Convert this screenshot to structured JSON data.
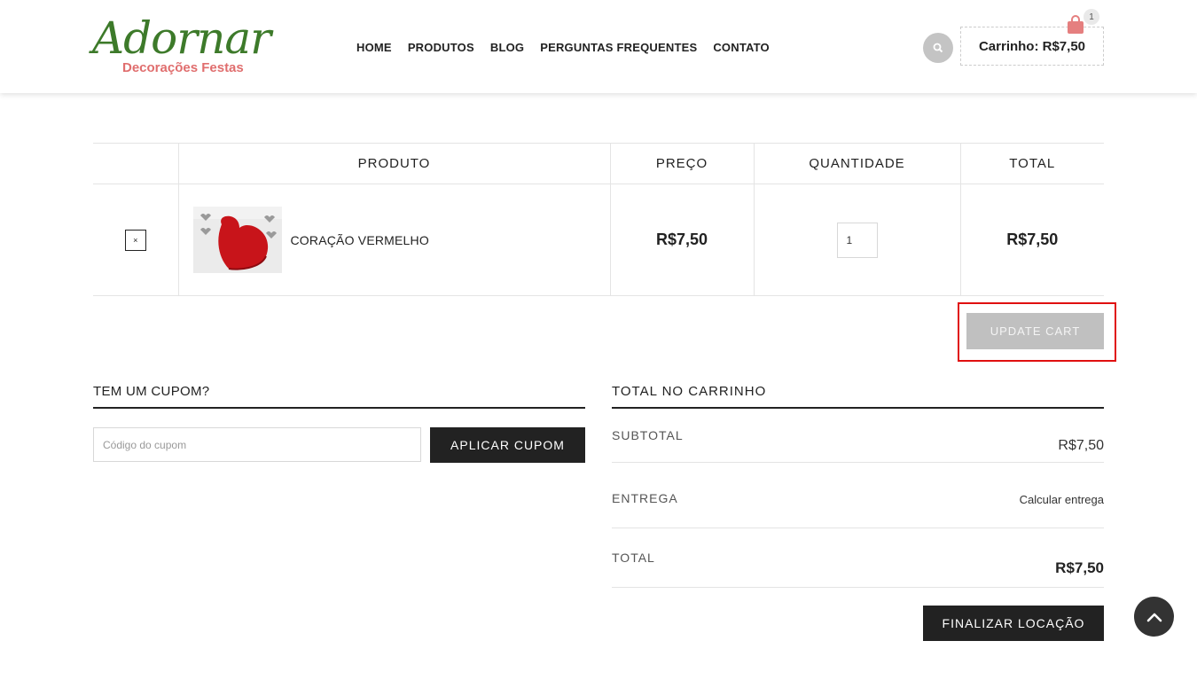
{
  "brand": {
    "logo_script": "Adornar",
    "logo_sub": "Decorações Festas"
  },
  "nav": {
    "items": [
      "HOME",
      "PRODUTOS",
      "BLOG",
      "PERGUNTAS FREQUENTES",
      "CONTATO"
    ]
  },
  "header": {
    "search_icon": "search-icon",
    "cart_label": "Carrinho: R$7,50",
    "cart_count": "1",
    "cart_icon": "shopping-bag-icon"
  },
  "table": {
    "headers": {
      "remove": "",
      "product": "PRODUTO",
      "price": "PREÇO",
      "quantity": "QUANTIDADE",
      "total": "TOTAL"
    },
    "rows": [
      {
        "remove": "×",
        "product_name": "CORAÇÃO VERMELHO",
        "price": "R$7,50",
        "quantity": "1",
        "total": "R$7,50"
      }
    ]
  },
  "update_cart_label": "UPDATE CART",
  "coupon": {
    "title": "TEM UM CUPOM?",
    "placeholder": "Código do cupom",
    "button": "APLICAR CUPOM"
  },
  "totals": {
    "title": "TOTAL NO CARRINHO",
    "subtotal_label": "SUBTOTAL",
    "subtotal_value": "R$7,50",
    "shipping_label": "ENTREGA",
    "shipping_value": "Calcular entrega",
    "total_label": "TOTAL",
    "total_value": "R$7,50",
    "checkout_button": "FINALIZAR LOCAÇÃO"
  },
  "colors": {
    "logo_green": "#3d7a2a",
    "logo_red": "#e06e6e",
    "highlight": "#e01010",
    "dark_button": "#222222",
    "disabled_button": "#c0c0c0"
  },
  "scroll_top_icon": "chevron-up-icon"
}
